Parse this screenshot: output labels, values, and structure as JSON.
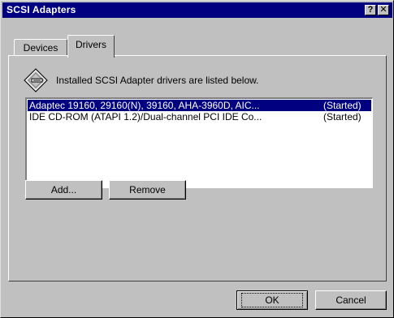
{
  "window": {
    "title": "SCSI Adapters",
    "help_glyph": "?",
    "close_glyph": "✕"
  },
  "tabs": [
    {
      "label": "Devices",
      "selected": false
    },
    {
      "label": "Drivers",
      "selected": true
    }
  ],
  "panel": {
    "info_text": "Installed SCSI Adapter drivers are listed below.",
    "info_icon": "scsi-diamond-icon",
    "drivers": [
      {
        "name": "Adaptec 19160, 29160(N), 39160, AHA-3960D, AIC...",
        "status": "(Started)",
        "selected": true
      },
      {
        "name": "IDE CD-ROM (ATAPI 1.2)/Dual-channel PCI IDE Co...",
        "status": "(Started)",
        "selected": false
      }
    ],
    "add_label": "Add...",
    "remove_label": "Remove"
  },
  "footer": {
    "ok_label": "OK",
    "cancel_label": "Cancel"
  },
  "colors": {
    "titlebar": "#000080",
    "face": "#c0c0c0",
    "selection": "#000080"
  }
}
